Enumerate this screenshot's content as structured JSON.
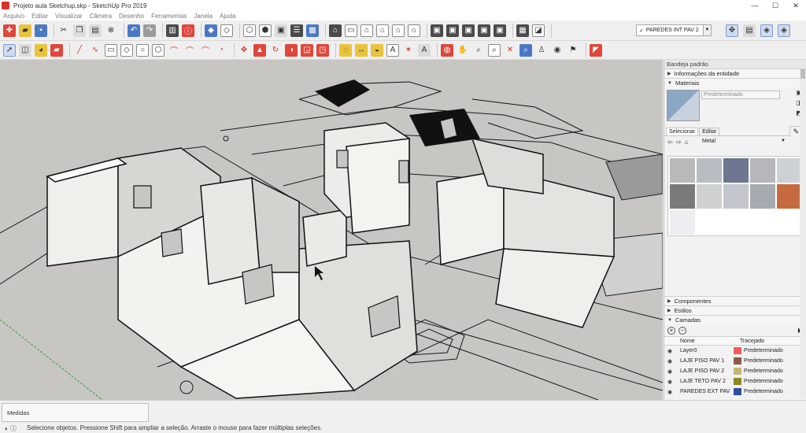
{
  "window": {
    "title": "Projeto aula Sketchup.skp - SketchUp Pro 2019",
    "minimize": "—",
    "maximize": "☐",
    "close": "✕"
  },
  "menu": [
    "Arquivo",
    "Editar",
    "Visualizar",
    "Câmera",
    "Desenho",
    "Ferramentas",
    "Janela",
    "Ajuda"
  ],
  "toolbar": {
    "active_layer": "PAREDES INT PAV 2"
  },
  "tray": {
    "title": "Bandeja padrão",
    "entity_info": "Informações da entidade",
    "materials": {
      "title": "Materiais",
      "material_name": "Predeterminado",
      "tabs": [
        "Selecionar",
        "Editar"
      ],
      "collection": "Metal",
      "swatches": [
        "#b9b9b9",
        "#b8bcc3",
        "#6e7690",
        "#b5b7ba",
        "#cdd0d4",
        "#7a7a7a",
        "#cfd0d2",
        "#c3c7cd",
        "#a7aab0",
        "#c56a3e",
        "#eeeef2"
      ]
    },
    "components": "Componentes",
    "styles": "Estilos",
    "layers": {
      "title": "Camadas",
      "col_name": "Nome",
      "col_trace": "Tracejado",
      "rows": [
        {
          "name": "Layer0",
          "trace": "Predeterminado",
          "color": "#f25a5a"
        },
        {
          "name": "LAJE PISO PAV 1",
          "trace": "Predeterminado",
          "color": "#8c5a4a"
        },
        {
          "name": "LAJE PISO PAV 2",
          "trace": "Predeterminado",
          "color": "#c7b67a"
        },
        {
          "name": "LAJE TETO PAV 2",
          "trace": "Predeterminado",
          "color": "#8a8a1e"
        },
        {
          "name": "PAREDES EXT PAV",
          "trace": "Predeterminado",
          "color": "#2f4fa0"
        }
      ]
    }
  },
  "status": {
    "measure_label": "Medidas",
    "message": "Selecione objetos. Pressione Shift para ampliar a seleção. Arraste o mouse para fazer múltiplas seleções."
  }
}
